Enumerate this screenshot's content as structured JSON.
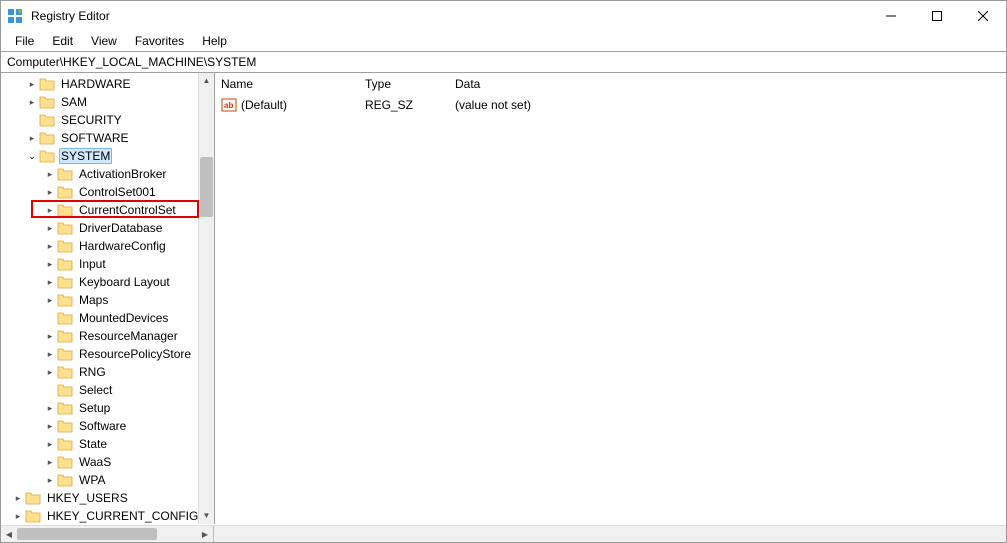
{
  "window": {
    "title": "Registry Editor"
  },
  "menu": {
    "file": "File",
    "edit": "Edit",
    "view": "View",
    "favorites": "Favorites",
    "help": "Help"
  },
  "address": "Computer\\HKEY_LOCAL_MACHINE\\SYSTEM",
  "tree": {
    "hardware": "HARDWARE",
    "sam": "SAM",
    "security": "SECURITY",
    "software": "SOFTWARE",
    "system": "SYSTEM",
    "system_children": {
      "activationbroker": "ActivationBroker",
      "controlset001": "ControlSet001",
      "currentcontrolset": "CurrentControlSet",
      "driverdatabase": "DriverDatabase",
      "hardwareconfig": "HardwareConfig",
      "input": "Input",
      "keyboardlayout": "Keyboard Layout",
      "maps": "Maps",
      "mounteddevices": "MountedDevices",
      "resourcemanager": "ResourceManager",
      "resourcepolicystore": "ResourcePolicyStore",
      "rng": "RNG",
      "select": "Select",
      "setup": "Setup",
      "software2": "Software",
      "state": "State",
      "waas": "WaaS",
      "wpa": "WPA"
    },
    "hkey_users": "HKEY_USERS",
    "hkey_current_config": "HKEY_CURRENT_CONFIG"
  },
  "list": {
    "header": {
      "name": "Name",
      "type": "Type",
      "data": "Data"
    },
    "rows": [
      {
        "name": "(Default)",
        "type": "REG_SZ",
        "data": "(value not set)"
      }
    ]
  }
}
